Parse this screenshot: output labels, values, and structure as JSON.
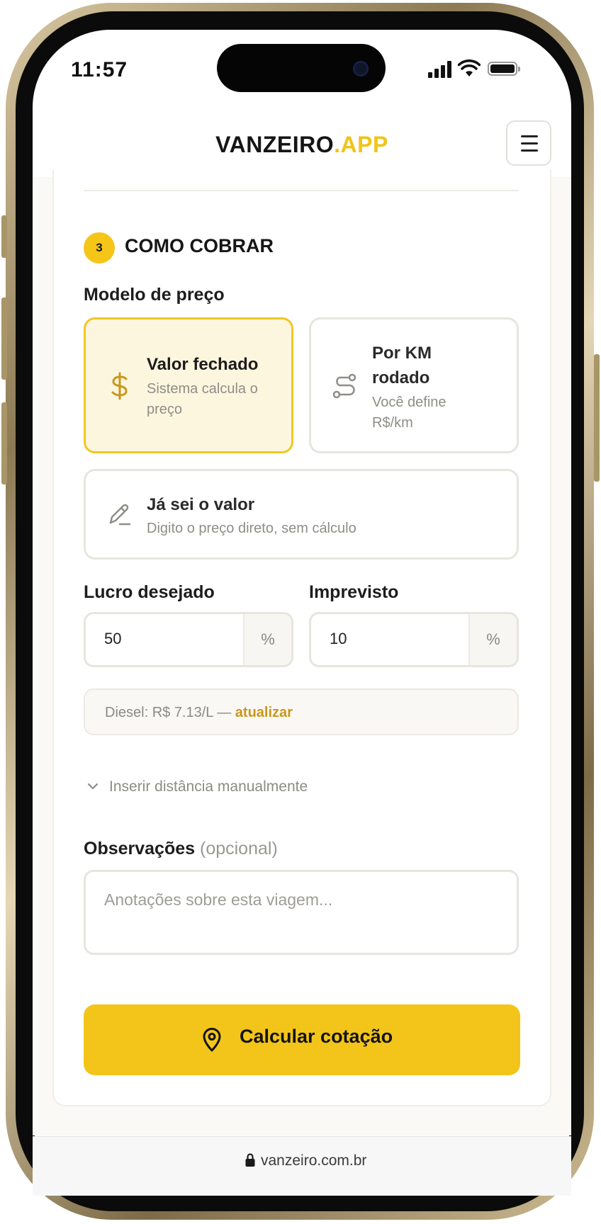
{
  "status_bar": {
    "time": "11:57"
  },
  "header": {
    "logo_main": "VANZEIRO",
    "logo_accent": ".APP",
    "menu_icon": "hamburger-icon"
  },
  "section": {
    "step_number": "3",
    "title": "COMO COBRAR"
  },
  "pricing_model": {
    "label": "Modelo de preço",
    "options": [
      {
        "title": "Valor fechado",
        "desc_line1": "Sistema calcula o",
        "desc_line2": "preço",
        "icon": "dollar-icon",
        "selected": true
      },
      {
        "title_line1": "Por KM",
        "title_line2": "rodado",
        "desc_line1": "Você define",
        "desc_line2": "R$/km",
        "icon": "route-icon",
        "selected": false
      },
      {
        "title": "Já sei o valor",
        "desc": "Digito o preço direto, sem cálculo",
        "icon": "pencil-icon",
        "selected": false
      }
    ]
  },
  "profit": {
    "label": "Lucro desejado",
    "value": "50",
    "suffix": "%"
  },
  "contingency": {
    "label": "Imprevisto",
    "value": "10",
    "suffix": "%"
  },
  "diesel": {
    "text": "Diesel: R$ 7.13/L — ",
    "link": "atualizar"
  },
  "manual_distance": {
    "label": "Inserir distância manualmente",
    "icon": "chevron-down-icon"
  },
  "notes": {
    "label": "Observações",
    "optional": "(opcional)",
    "placeholder": "Anotações sobre esta viagem..."
  },
  "cta": {
    "label": "Calcular cotação",
    "icon": "map-pin-icon"
  },
  "url_bar": {
    "url": "vanzeiro.com.br",
    "icon": "lock-icon"
  },
  "colors": {
    "accent": "#f3c51b",
    "accent_text": "#c9971a",
    "selected_bg": "#fcf6df"
  }
}
